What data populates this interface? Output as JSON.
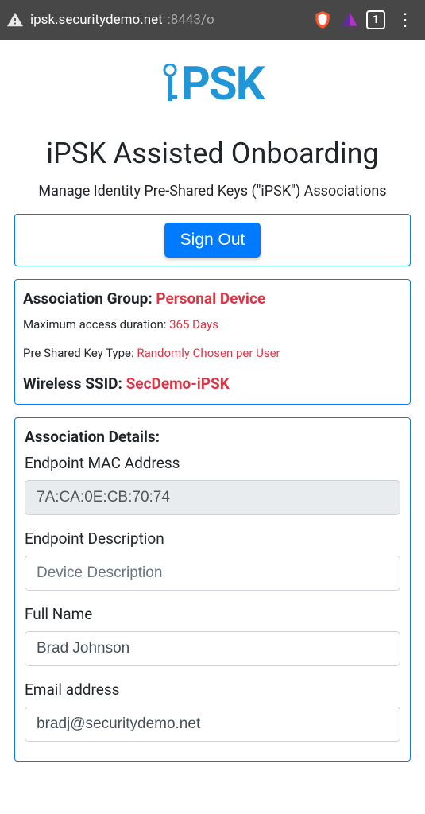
{
  "browser": {
    "url_host": "ipsk.securitydemo.net",
    "url_rest": ":8443/o",
    "tab_count": "1"
  },
  "logo": {
    "text_i": "i",
    "text_rest": "PSK"
  },
  "header": {
    "title": "iPSK Assisted Onboarding",
    "subtitle": "Manage Identity Pre-Shared Keys (\"iPSK\") Associations"
  },
  "actions": {
    "sign_out": "Sign Out"
  },
  "group_card": {
    "assoc_group_label": "Association Group: ",
    "assoc_group_value": "Personal Device",
    "max_duration_label": "Maximum access duration: ",
    "max_duration_value": "365 Days",
    "psk_type_label": "Pre Shared Key Type: ",
    "psk_type_value": "Randomly Chosen per User",
    "ssid_label": "Wireless SSID: ",
    "ssid_value": "SecDemo-iPSK"
  },
  "details": {
    "heading": "Association Details:",
    "mac_label": "Endpoint MAC Address",
    "mac_value": "7A:CA:0E:CB:70:74",
    "desc_label": "Endpoint Description",
    "desc_placeholder": "Device Description",
    "desc_value": "",
    "name_label": "Full Name",
    "name_value": "Brad Johnson",
    "email_label": "Email address",
    "email_value": "bradj@securitydemo.net"
  }
}
